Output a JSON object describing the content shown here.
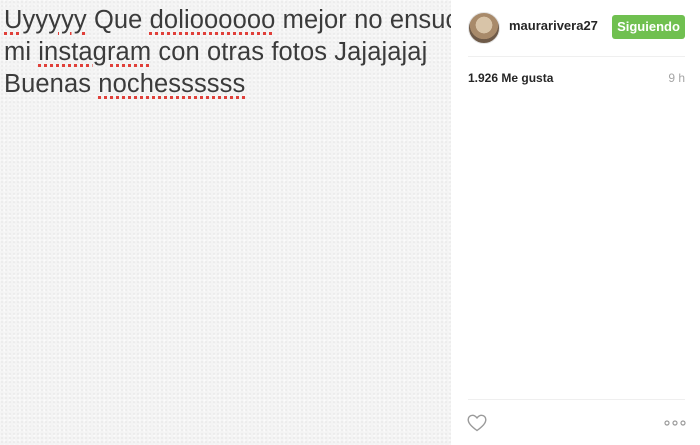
{
  "post": {
    "text_lines": [
      [
        {
          "text": "Uyyyyy",
          "misspelled": true
        },
        {
          "text": " Que ",
          "misspelled": false
        },
        {
          "text": "dolioooooo",
          "misspelled": true
        },
        {
          "text": " mejor no ensucio",
          "misspelled": false
        }
      ],
      [
        {
          "text": "mi ",
          "misspelled": false
        },
        {
          "text": "instagram",
          "misspelled": true
        },
        {
          "text": " con otras fotos Jajajajaj",
          "misspelled": false
        }
      ],
      [
        {
          "text": "Buenas ",
          "misspelled": false
        },
        {
          "text": "nochessssss",
          "misspelled": true
        }
      ]
    ],
    "underline_color": "#e0403a",
    "text_color": "#3b3b3b"
  },
  "sidebar": {
    "avatar_icon": "profile-avatar",
    "username": "maurarivera27",
    "follow_button_label": "Siguiendo",
    "follow_button_color": "#70c050",
    "likes_text": "1.926 Me gusta",
    "time_text": "9 h",
    "like_icon": "heart-outline-icon",
    "more_icon": "more-options-icon"
  }
}
